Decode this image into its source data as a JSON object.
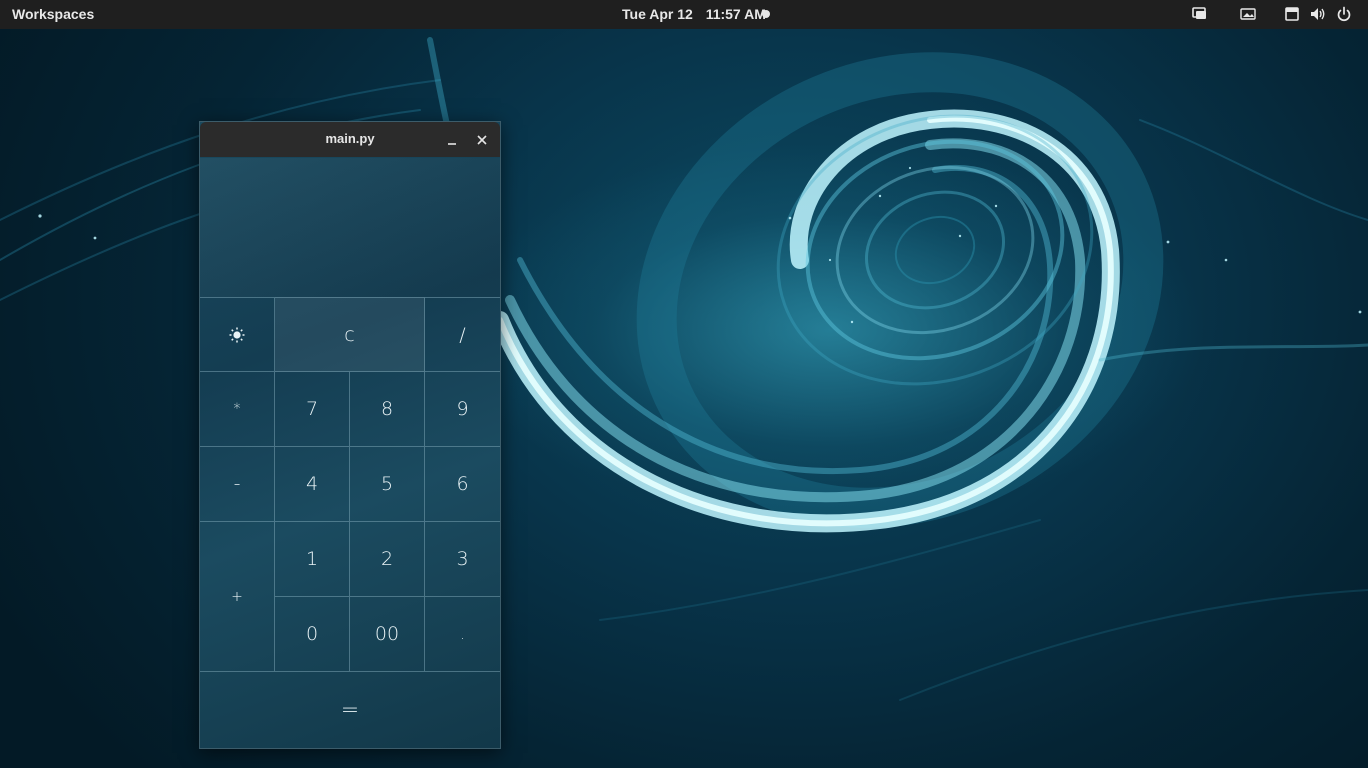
{
  "topbar": {
    "workspaces": "Workspaces",
    "date": "Tue Apr 12",
    "time": "11:57 AM",
    "tray_icons": [
      "screen-share-icon",
      "display-icon",
      "keyboard-layout-icon",
      "volume-icon",
      "power-icon"
    ]
  },
  "window": {
    "title": "main.py",
    "display_value": ""
  },
  "keypad": {
    "theme_icon": "sun-icon",
    "clear": "c",
    "divide": "/",
    "multiply": "*",
    "seven": "7",
    "eight": "8",
    "nine": "9",
    "minus": "-",
    "four": "4",
    "five": "5",
    "six": "6",
    "plus": "+",
    "one": "1",
    "two": "2",
    "three": "3",
    "zero": "0",
    "double_zero": "00",
    "decimal": ".",
    "equals": "="
  },
  "colors": {
    "topbar": "#1f1f1f",
    "titlebar": "#2b2b2b",
    "accent": "#1a4a5f"
  }
}
